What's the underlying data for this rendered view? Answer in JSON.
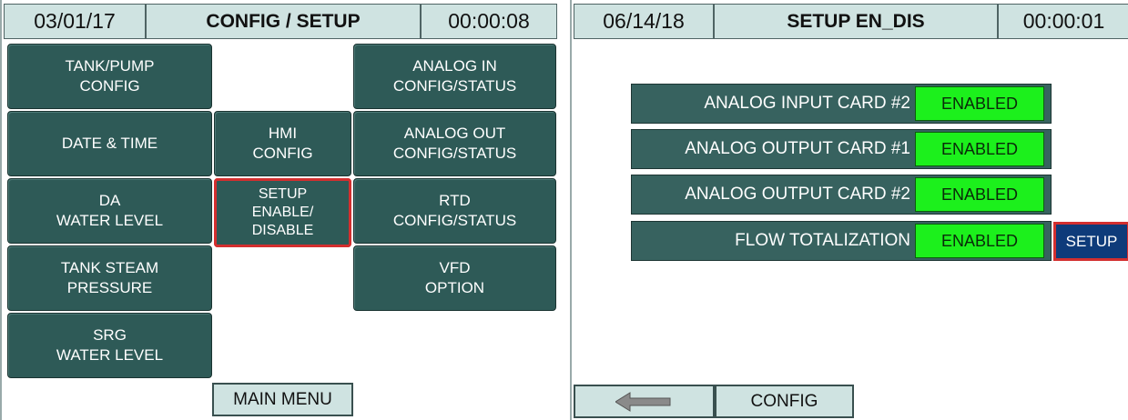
{
  "left_panel": {
    "date": "03/01/17",
    "title": "CONFIG / SETUP",
    "timer": "00:00:08",
    "buttons": {
      "tank_pump": [
        "TANK/PUMP",
        "CONFIG"
      ],
      "date_time": [
        "DATE & TIME"
      ],
      "da_water": [
        "DA",
        "WATER LEVEL"
      ],
      "tank_steam": [
        "TANK STEAM",
        "PRESSURE"
      ],
      "srg_water": [
        "SRG",
        "WATER LEVEL"
      ],
      "hmi_config": [
        "HMI",
        "CONFIG"
      ],
      "setup_enable": [
        "SETUP",
        "ENABLE/",
        "DISABLE"
      ],
      "analog_in": [
        "ANALOG IN",
        "CONFIG/STATUS"
      ],
      "analog_out": [
        "ANALOG OUT",
        "CONFIG/STATUS"
      ],
      "rtd": [
        "RTD",
        "CONFIG/STATUS"
      ],
      "vfd": [
        "VFD",
        "OPTION"
      ]
    },
    "main_menu": "MAIN MENU"
  },
  "right_panel": {
    "date": "06/14/18",
    "title": "SETUP EN_DIS",
    "timer": "00:00:01",
    "rows": [
      {
        "label": "ANALOG INPUT CARD #2",
        "status": "ENABLED"
      },
      {
        "label": "ANALOG OUTPUT CARD #1",
        "status": "ENABLED"
      },
      {
        "label": "ANALOG OUTPUT CARD #2",
        "status": "ENABLED"
      },
      {
        "label": "FLOW TOTALIZATION",
        "status": "ENABLED"
      }
    ],
    "setup_button": "SETUP",
    "back_icon": "left-arrow-icon",
    "config_button": "CONFIG"
  },
  "colors": {
    "tile": "#2e5a57",
    "header": "#cfe3e1",
    "enabled": "#1cf01c",
    "highlight": "#d32f2f",
    "setup_button": "#0e3b7a"
  }
}
